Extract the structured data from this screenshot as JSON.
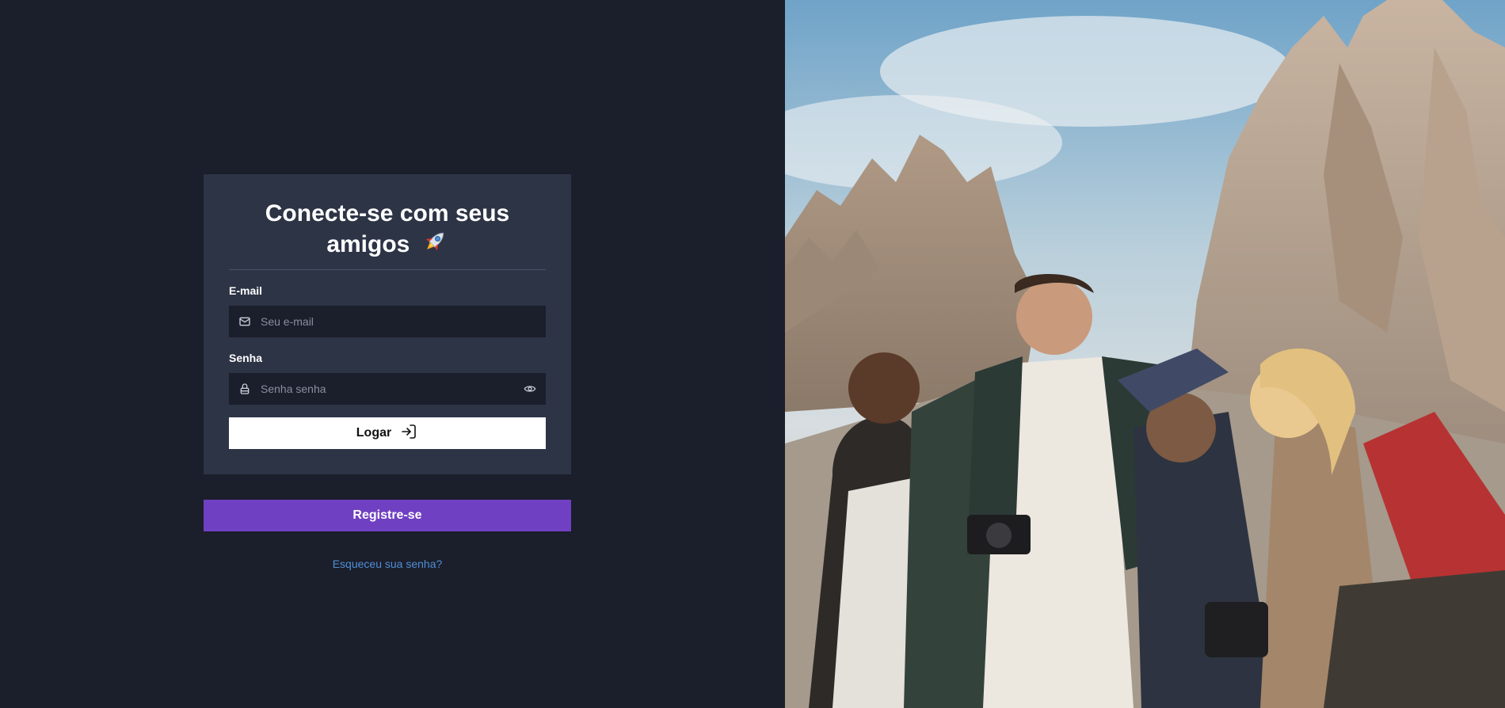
{
  "login": {
    "title": "Conecte-se com seus amigos",
    "email_label": "E-mail",
    "email_placeholder": "Seu e-mail",
    "email_value": "",
    "password_label": "Senha",
    "password_placeholder": "Senha senha",
    "password_value": "",
    "submit_label": "Logar"
  },
  "register_label": "Registre-se",
  "forgot_label": "Esqueceu sua senha?",
  "icons": {
    "title": "rocket-icon",
    "email": "mail-icon",
    "password": "lock-icon",
    "toggle": "eye-icon",
    "submit": "log-in-icon"
  },
  "colors": {
    "background": "#1b1e2b",
    "card": "#2d3446",
    "register": "#7040c2",
    "link": "#4f8fd6"
  }
}
